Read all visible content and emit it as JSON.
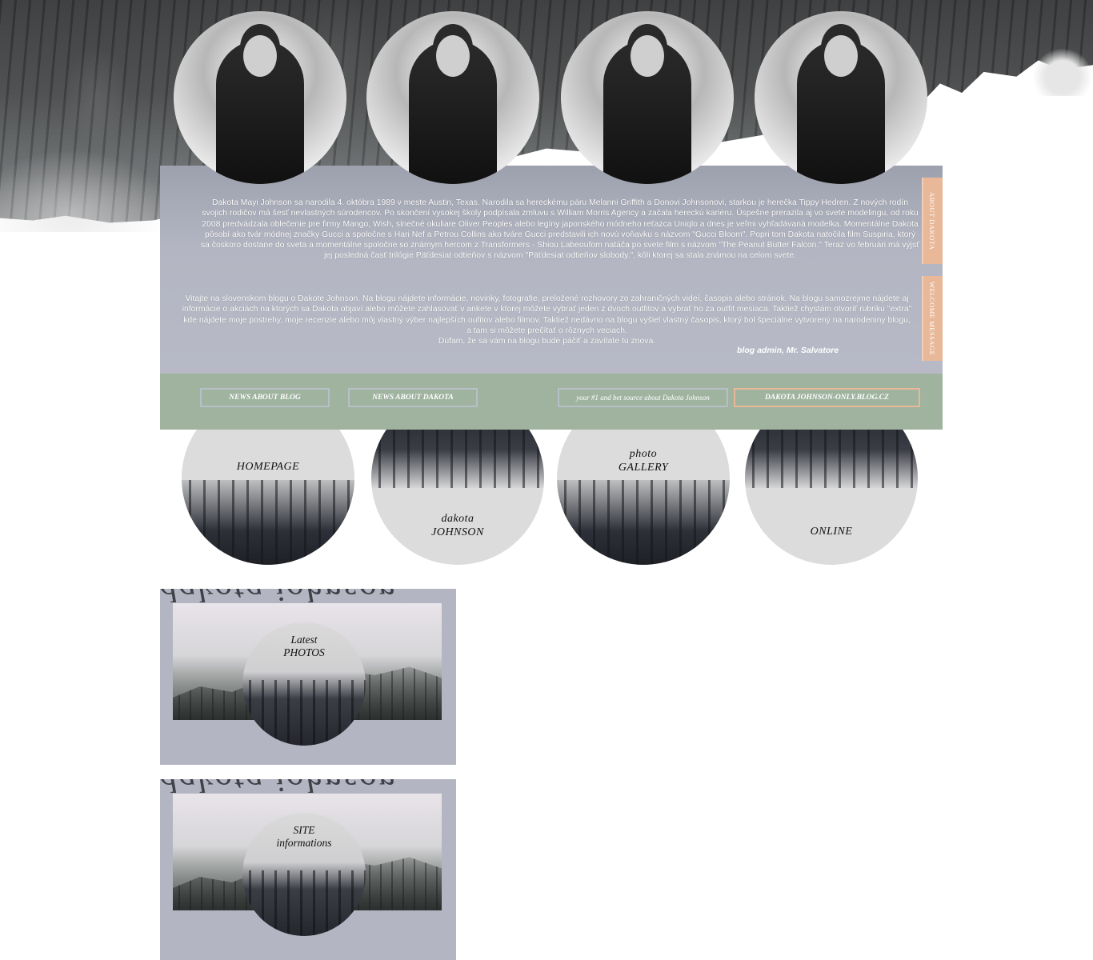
{
  "header": {
    "portraits": [
      {
        "name": "portrait-1"
      },
      {
        "name": "portrait-2"
      },
      {
        "name": "portrait-3"
      },
      {
        "name": "portrait-4"
      }
    ]
  },
  "about": {
    "text": "Dakota Mayi Johnson sa narodila 4. októbra 1989 v meste Austin, Texas. Narodila sa hereckému páru Melanni Griffith a Donovi Johnsonovi, starkou je herečka Tippy Hedren. Z nových rodín svojich rodičov má šesť nevlastných súrodencov. Po skončení vysokej školy podpísala zmluvu s William Morris Agency a začala hereckú kariéru. Úspešne prerazila aj vo svete modelingu, od roku 2008 predvádzala oblečenie pre firmy Mango, Wish, slnečné okuliare Oliver Peoples alebo legíny japonského módneho reťazca Uniqlo a dnes je veľmi vyhľadávaná modelka. Momentálne Dakota pôsobí ako tvár módnej značky Gucci a spoločne s Hari Nef a Petrou Collins ako tváre Gucci predstavili ich novú voňavku s názvom \"Gucci Bloom\". Popri tom Dakota natočila film Suspiria, ktorý sa čoskoro dostane do sveta a momentálne spoločne so známym hercom z Transformers - Shiou Labeoufom natáča po svete film s názvom \"The Peanut Butter Falcon.\" Teraz vo februári má výjsť jej posledná časť trilógie Päťdesiat odtieňov s názvom \"Päťdesiat odtieňov slobody.\", kôli ktorej sa stala známou na celom svete.",
    "tab_label": "ABOUT DAKOTA"
  },
  "welcome": {
    "text": "Vitajte na slovenskom blogu o Dakote Johnson. Na blogu nájdete informácie, novinky, fotografie, preložené rozhovory zo zahraničných videí, časopis alebo stránok.  Na blogu samozrejme nájdete aj informácie o akciách na ktorých sa Dakota objaví alebo môžete zahlasovať v ankete v ktorej môžete vybrať jeden z dvoch outfitov a vybrať ho za outfit mesiaca. Taktiež chystám otvoriť rubriku \"extra\" kde nájdete moje postrehy, moje recenzie alebo môj vlastný výber najlepších oufitov alebo filmov. Taktiež nedávno na blogu vyšiel vlastný časopis, ktorý bol špeciálne vytvorený na narodeniny blogu, a tam si môžete prečítať o rôznych veciach.",
    "closing": "Dúfam,  že sa vám na blogu bude páčiť a zavítate tu znova.",
    "signature": "blog admin, Mr. Salvatore",
    "tab_label": "WELCOME MESSAGE"
  },
  "nav": {
    "news_blog": "NEWS ABOUT BLOG",
    "news_dakota": "NEWS ABOUT DAKOTA",
    "tagline": "your #1 and bet source about Dakota Johnson",
    "site_url": "DAKOTA JOHNSON-ONLY.BLOG.CZ"
  },
  "menu": {
    "homepage": "HOMEPAGE",
    "dakota_line1": "dakota",
    "dakota_line2": "JOHNSON",
    "gallery_line1": "photo",
    "gallery_line2": "GALLERY",
    "online": "ONLINE"
  },
  "boxes": {
    "photos_word": "dakota johnson",
    "photos_line1": "Latest",
    "photos_line2": "PHOTOS",
    "info_word": "dakota johnson",
    "info_line1": "SITE",
    "info_line2": "informations"
  },
  "colors": {
    "panel": "#b3b6c2",
    "nav_green": "#9fb39f",
    "tab_peach": "#e8b898"
  }
}
